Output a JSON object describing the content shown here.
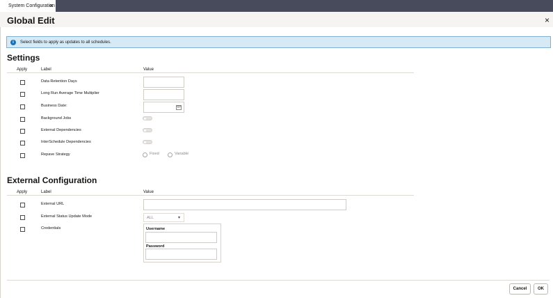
{
  "tab": {
    "label": "System Configuration",
    "close": "×"
  },
  "dialog": {
    "title": "Global Edit",
    "close": "×",
    "info": "Select fields to apply as updates to all schedules."
  },
  "settings": {
    "title": "Settings",
    "columns": {
      "apply": "Apply",
      "label": "Label",
      "value": "Value"
    },
    "rows": [
      {
        "label": "Data Retention Days"
      },
      {
        "label": "Long Run Average Time Multiplier"
      },
      {
        "label": "Business Date:"
      },
      {
        "label": "Background Jobs"
      },
      {
        "label": "External Dependencies"
      },
      {
        "label": "InterSchedule Dependencies"
      },
      {
        "label": "Repave Strategy"
      }
    ],
    "repave_options": [
      "Fixed",
      "Variable"
    ]
  },
  "external": {
    "title": "External Configuration",
    "columns": {
      "apply": "Apply",
      "label": "Label",
      "value": "Value"
    },
    "rows": [
      {
        "label": "External URL"
      },
      {
        "label": "External Status Update Mode"
      },
      {
        "label": "Credentials"
      }
    ],
    "mode_value": "ALL",
    "username_label": "Username",
    "password_label": "Password"
  },
  "footer": {
    "cancel": "Cancel",
    "ok": "OK"
  },
  "colors": {
    "topbar": "#484b5c",
    "banner": "#d6eaf6",
    "info_icon": "#1a71b6"
  }
}
